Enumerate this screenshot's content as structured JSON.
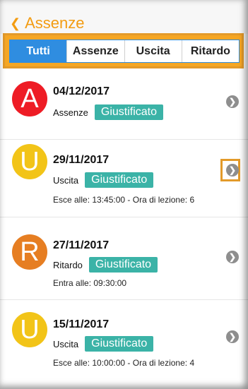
{
  "header": {
    "back_label": "Assenze",
    "back_icon": "chevron-left-icon"
  },
  "tabs": [
    "Tutti",
    "Assenze",
    "Uscita",
    "Ritardo"
  ],
  "active_tab": "Tutti",
  "items": [
    {
      "letter": "A",
      "color": "#ee1c25",
      "date": "04/12/2017",
      "type": "Assenze",
      "status": "Giustificato",
      "detail": ""
    },
    {
      "letter": "U",
      "color": "#f2c418",
      "date": "29/11/2017",
      "type": "Uscita",
      "status": "Giustificato",
      "detail": "Esce alle: 13:45:00 - Ora di lezione: 6"
    },
    {
      "letter": "R",
      "color": "#e67e22",
      "date": "27/11/2017",
      "type": "Ritardo",
      "status": "Giustificato",
      "detail": "Entra alle: 09:30:00"
    },
    {
      "letter": "U",
      "color": "#f2c418",
      "date": "15/11/2017",
      "type": "Uscita",
      "status": "Giustificato",
      "detail": "Esce alle: 10:00:00 - Ora di lezione: 4"
    }
  ],
  "colors": {
    "accent": "#f39c12",
    "tab_active": "#2f8de0",
    "badge": "#3bb3a7",
    "highlight": "#e39a2a"
  }
}
